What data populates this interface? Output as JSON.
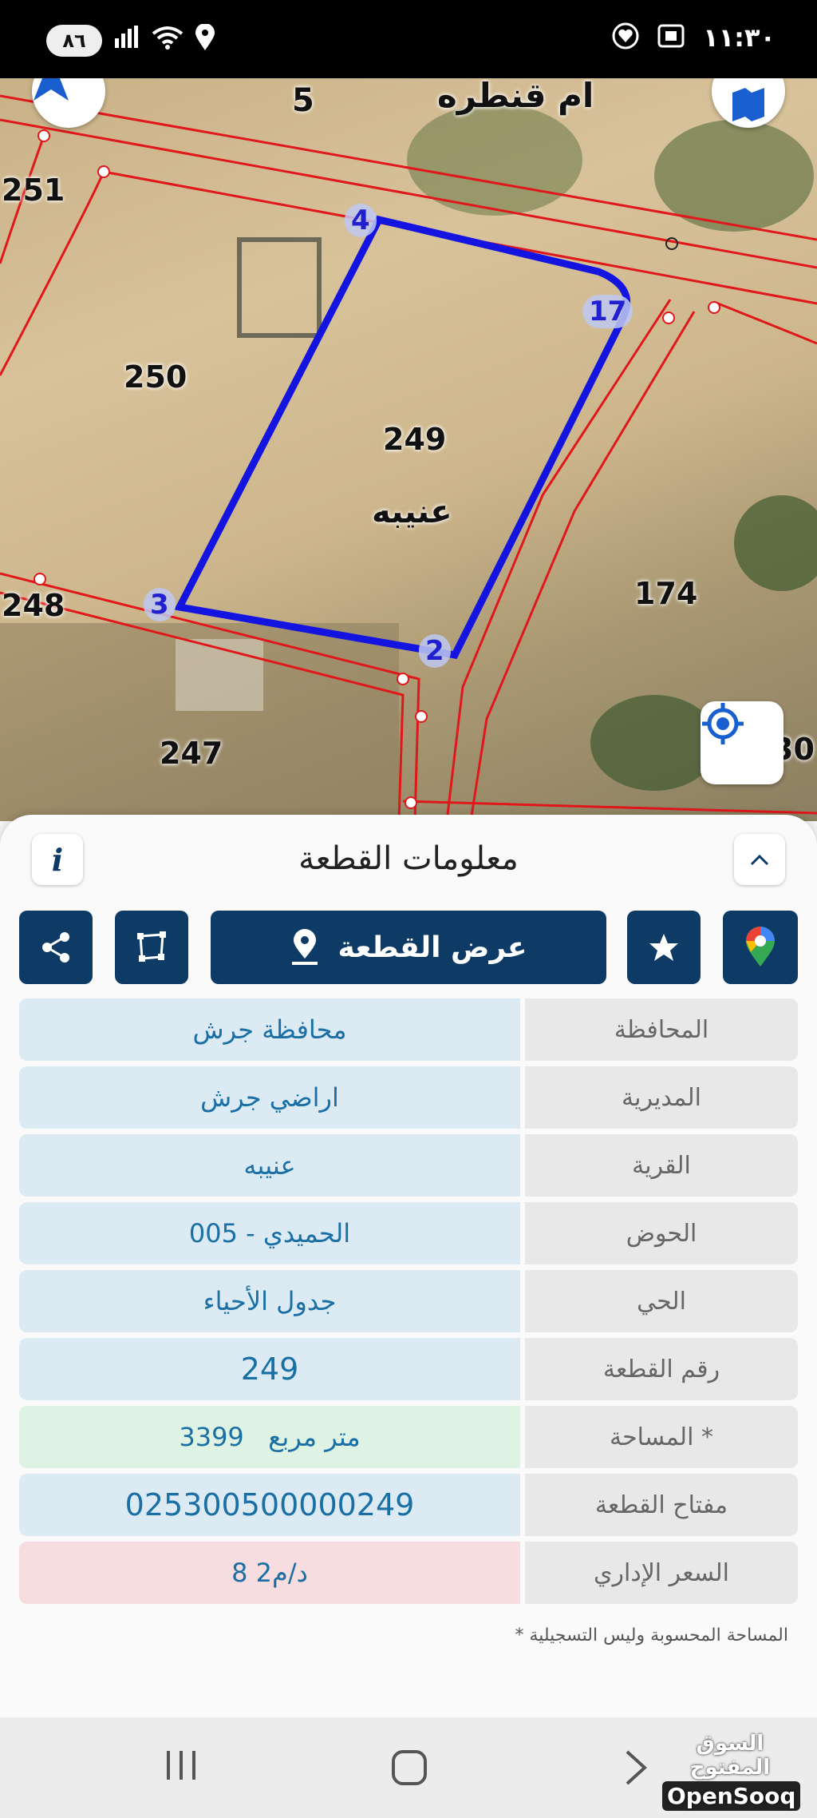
{
  "status_bar": {
    "battery": "٨٦",
    "clock": "١١:٣٠",
    "left_icons": [
      "signal-icon",
      "wifi-icon",
      "location-icon"
    ],
    "right_icons": [
      "heart-icon",
      "screen-record-icon"
    ]
  },
  "map": {
    "area_name": "ام قنطره",
    "parcel_labels": [
      "5",
      "251",
      "250",
      "249",
      "248",
      "247",
      "174",
      "30"
    ],
    "village_label": "عنيبه",
    "vertices": [
      "4",
      "17",
      "3",
      "2"
    ],
    "colors": {
      "boundary": "#e0171b",
      "selected": "#1414e0"
    }
  },
  "sheet": {
    "title": "معلومات القطعة",
    "info_glyph": "i",
    "show_parcel_label": "عرض القطعة",
    "rows": [
      {
        "key": "المحافظة",
        "value": "محافظة جرش",
        "tone": "blue"
      },
      {
        "key": "المديرية",
        "value": "اراضي جرش",
        "tone": "blue"
      },
      {
        "key": "القرية",
        "value": "عنيبه",
        "tone": "blue"
      },
      {
        "key": "الحوض",
        "value": "الحميدي - 005",
        "tone": "blue"
      },
      {
        "key": "الحي",
        "value": "جدول الأحياء",
        "tone": "blue"
      },
      {
        "key": "رقم القطعة",
        "value": "249",
        "tone": "blue"
      },
      {
        "key": "المساحة *",
        "value": "3399   متر مربع",
        "tone": "green"
      },
      {
        "key": "مفتاح القطعة",
        "value": "025300500000249",
        "tone": "blue"
      },
      {
        "key": "السعر الإداري",
        "value": "8 د/م2",
        "tone": "red"
      }
    ],
    "footnote": "* المساحة المحسوبة وليس التسجيلية"
  },
  "nav": {
    "watermark_ar": "السوق المفتوح",
    "watermark_en": "OpenSooq"
  }
}
